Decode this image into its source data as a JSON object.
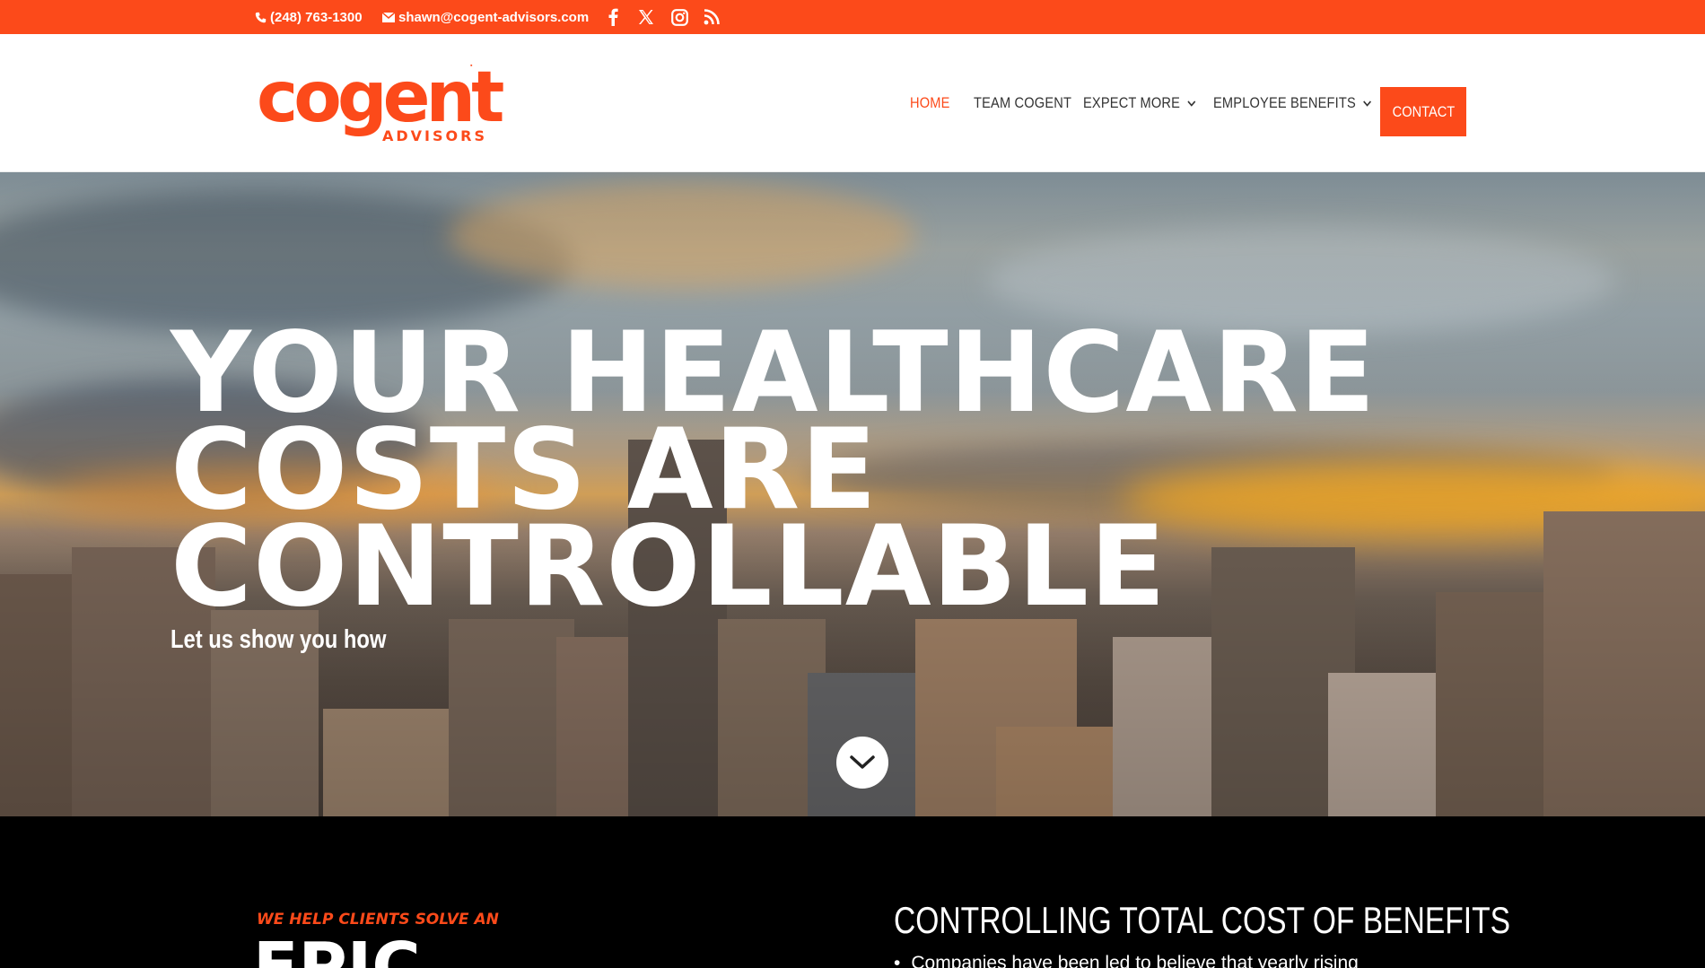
{
  "colors": {
    "brand": "#fc4a1a",
    "dark": "#000000",
    "nav_text": "#333333"
  },
  "topbar": {
    "phone": "(248) 763-1300",
    "email": "shawn@cogent-advisors.com",
    "social_icons": [
      "facebook-icon",
      "x-icon",
      "instagram-icon",
      "rss-icon"
    ]
  },
  "header": {
    "logo_word": "cogent",
    "logo_sub": "ADVISORS",
    "nav": {
      "home": "HOME",
      "team": "TEAM COGENT",
      "expect": "EXPECT MORE",
      "benefits": "EMPLOYEE BENEFITS",
      "contact": "CONTACT"
    }
  },
  "hero": {
    "line1": "YOUR HEALTHCARE",
    "line2": "COSTS ARE",
    "line3": "CONTROLLABLE",
    "subhead": "Let us show you how"
  },
  "section": {
    "eyebrow": "WE HELP CLIENTS SOLVE AN",
    "big_word": "EPIC",
    "title": "CONTROLLING TOTAL COST OF BENEFITS",
    "bullet": "Companies have been led to believe that yearly rising"
  }
}
